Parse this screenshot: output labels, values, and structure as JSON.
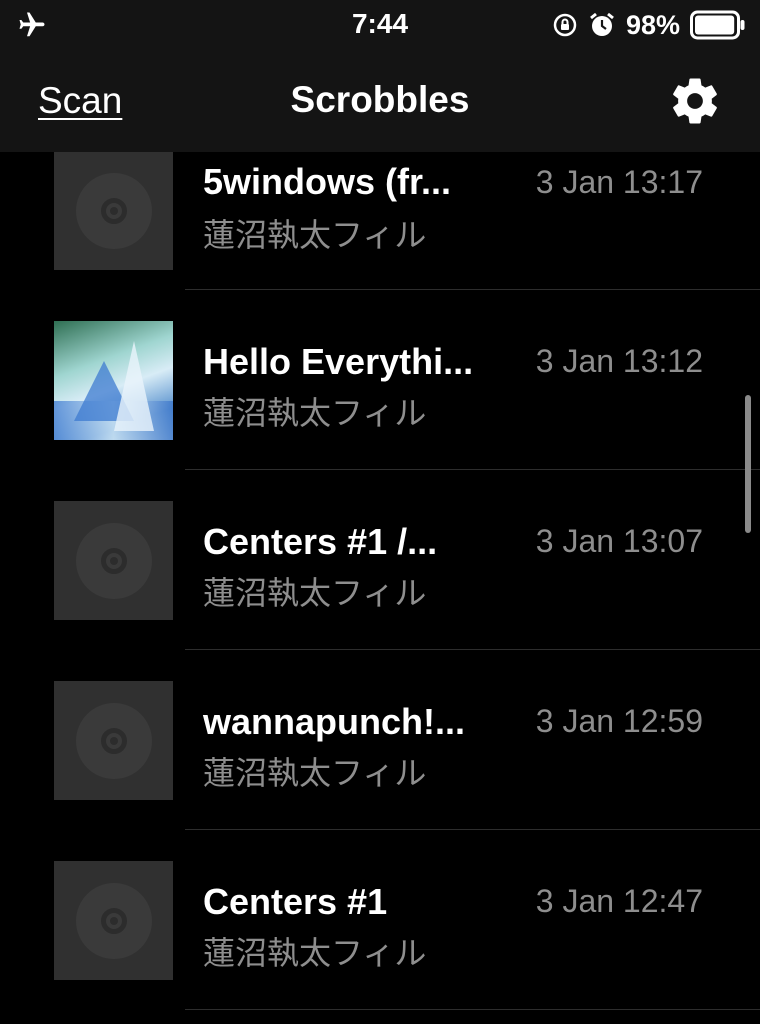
{
  "status_bar": {
    "time": "7:44",
    "battery_percent": "98%",
    "battery_level": 0.98,
    "icons": [
      "airplane-icon",
      "orientation-lock-icon",
      "alarm-icon",
      "battery-icon"
    ]
  },
  "nav": {
    "left_label": "Scan",
    "title": "Scrobbles",
    "right_icon": "gear-icon"
  },
  "scrobbles": [
    {
      "track": "5windows (fr...",
      "artist": "蓮沼執太フィル",
      "date": "3 Jan 13:17",
      "artwork": "placeholder-disc"
    },
    {
      "track": "Hello Everythi...",
      "artist": "蓮沼執太フィル",
      "date": "3 Jan 13:12",
      "artwork": "album-cover"
    },
    {
      "track": "Centers #1 /...",
      "artist": "蓮沼執太フィル",
      "date": "3 Jan 13:07",
      "artwork": "placeholder-disc"
    },
    {
      "track": "wannapunch!...",
      "artist": "蓮沼執太フィル",
      "date": "3 Jan 12:59",
      "artwork": "placeholder-disc"
    },
    {
      "track": "Centers #1",
      "artist": "蓮沼執太フィル",
      "date": "3 Jan 12:47",
      "artwork": "placeholder-disc"
    }
  ],
  "colors": {
    "background": "#000000",
    "bar_background": "#141414",
    "secondary_text": "#8e8e8e",
    "placeholder_art": "#303030"
  }
}
